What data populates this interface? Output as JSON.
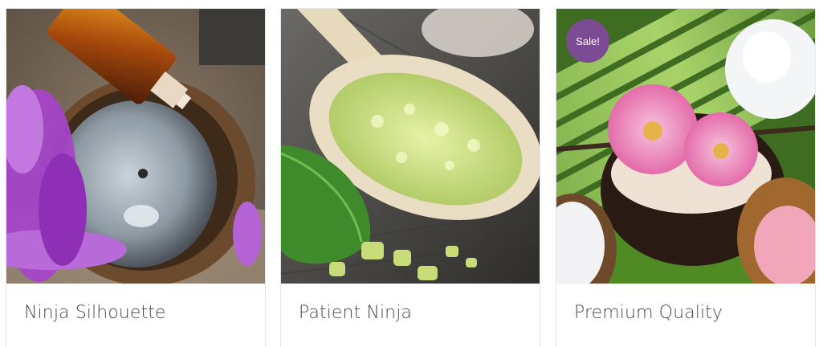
{
  "products": [
    {
      "title": "Ninja Silhouette",
      "image": "essential-oil-bowl-photo"
    },
    {
      "title": "Patient Ninja",
      "image": "bath-salt-spoon-photo"
    },
    {
      "title": "Premium Quality",
      "image": "spa-flowers-bamboo-photo",
      "badge": "Sale!"
    }
  ],
  "colors": {
    "badge_background": "#7b4b94",
    "title_text": "#4a4a4a",
    "card_border": "#e6e6e6"
  }
}
